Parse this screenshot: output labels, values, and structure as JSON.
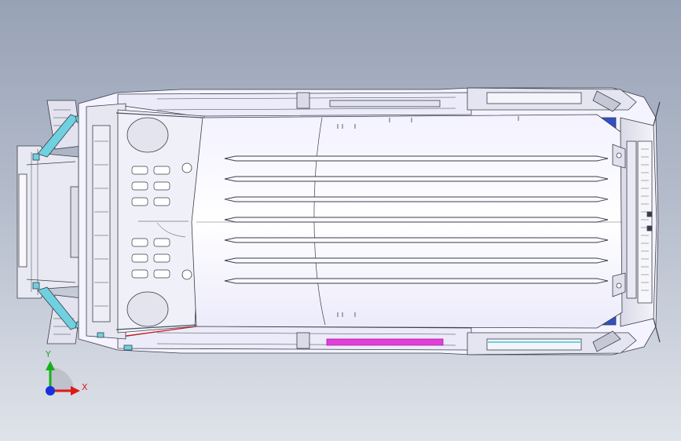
{
  "viewport": {
    "model": "vehicle-body-in-white",
    "view": "top",
    "colors": {
      "background_top": "#98a2b6",
      "background_bottom": "#dfe3ea",
      "body_fill": "#f4f3ff",
      "line": "#3a3d4a",
      "accent_cyan": "#6fd0e0",
      "accent_magenta": "#e040d8",
      "accent_blue": "#3050c8",
      "accent_red": "#d82020"
    }
  },
  "triad": {
    "x_label": "X",
    "y_label": "Y",
    "x_color": "#e01818",
    "y_color": "#18b018",
    "z_color": "#1830e0"
  }
}
